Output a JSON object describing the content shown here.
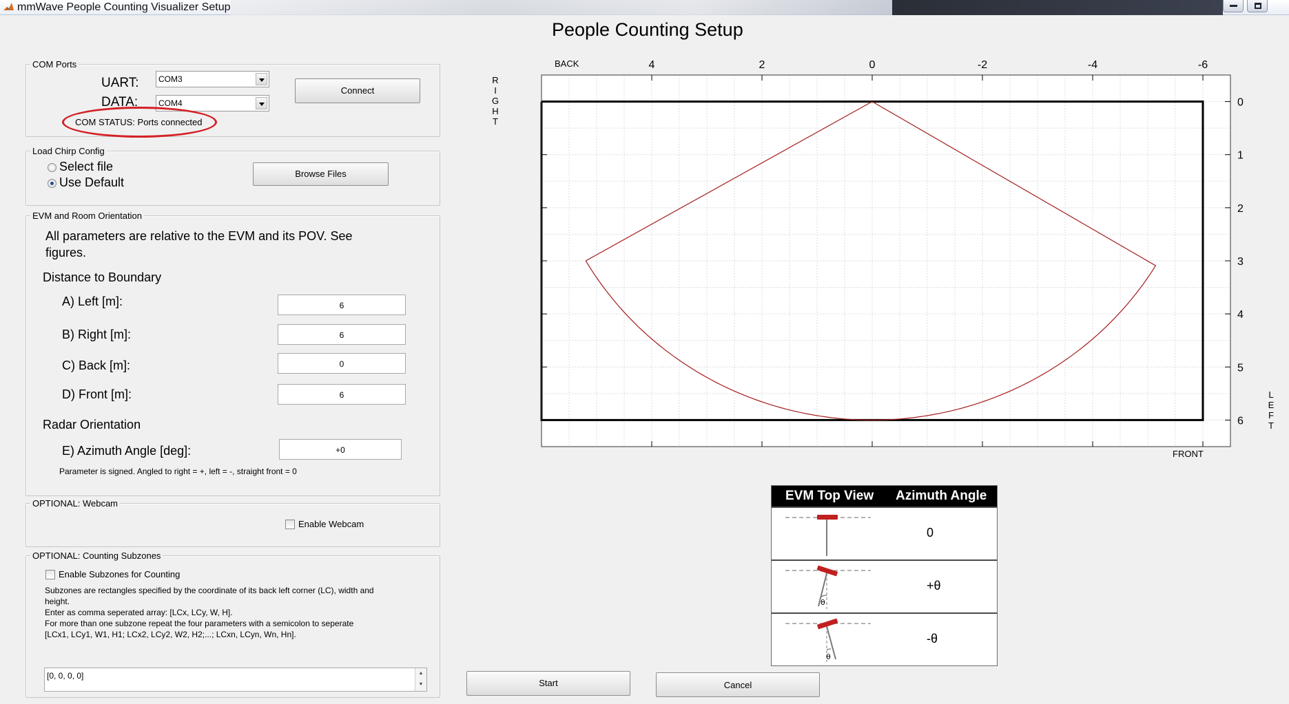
{
  "window": {
    "title": "mmWave People Counting Visualizer Setup"
  },
  "page_title": "People Counting Setup",
  "com_ports": {
    "legend": "COM Ports",
    "uart_label": "UART:",
    "uart_value": "COM3",
    "data_label": "DATA:",
    "data_value": "COM4",
    "connect_label": "Connect",
    "status": "COM STATUS: Ports connected"
  },
  "chirp_config": {
    "legend": "Load Chirp Config",
    "options": [
      "Select file",
      "Use Default"
    ],
    "selected": "Use Default",
    "browse_label": "Browse Files"
  },
  "orientation": {
    "legend": "EVM and Room Orientation",
    "intro_line1": "All parameters are relative to the EVM and its POV.  See",
    "intro_line2": "figures.",
    "distance_heading": "Distance to Boundary",
    "left_label": "A) Left [m]:",
    "left_value": "6",
    "right_label": "B) Right [m]:",
    "right_value": "6",
    "back_label": "C) Back [m]:",
    "back_value": "0",
    "front_label": "D) Front [m]:",
    "front_value": "6",
    "radar_heading": "Radar Orientation",
    "azimuth_label": "E) Azimuth Angle [deg]:",
    "azimuth_value": "+0",
    "azimuth_note": "Parameter is signed. Angled to right = +, left = -, straight front = 0"
  },
  "webcam": {
    "legend": "OPTIONAL: Webcam",
    "enable_label": "Enable Webcam",
    "checked": false
  },
  "subzones": {
    "legend": "OPTIONAL: Counting Subzones",
    "enable_label": "Enable Subzones for Counting",
    "checked": false,
    "help_lines": [
      "Subzones are rectangles specified by the coordinate of its back left corner (LC), width and",
      "height.",
      "Enter as comma seperated array: [LCx, LCy, W, H].",
      "For more than one subzone repeat the four parameters with a semicolon to seperate",
      "[LCx1, LCy1, W1, H1; LCx2, LCy2, W2, H2;...; LCxn, LCyn, Wn, Hn]."
    ],
    "input_value": "[0, 0, 0, 0]"
  },
  "buttons": {
    "start_label": "Start",
    "cancel_label": "Cancel"
  },
  "chart_data": {
    "type": "line",
    "title": "",
    "top_axis_label": "BACK",
    "bottom_axis_label": "FRONT",
    "left_axis_label": "RIGHT",
    "right_axis_label": "LEFT",
    "x_ticks": [
      4,
      2,
      0,
      -2,
      -4,
      -6
    ],
    "y_ticks": [
      0,
      1,
      2,
      3,
      4,
      5,
      6
    ],
    "xlim": [
      6,
      -6.5
    ],
    "ylim": [
      -0.5,
      6.5
    ],
    "grid": true,
    "colors": {
      "boundary": "#000000",
      "coverage": "#a31c1c",
      "grid": "#dcdcdc"
    },
    "series": [
      {
        "name": "",
        "role": "boundary",
        "x": [
          6,
          -6,
          -6,
          6,
          6
        ],
        "y": [
          0,
          0,
          6,
          6,
          0
        ]
      },
      {
        "name": "",
        "role": "coverage",
        "sector_apex": [
          0,
          0
        ],
        "sector_radius": 6,
        "sector_half_angle_deg": 60
      }
    ]
  },
  "evm_table": {
    "headers": [
      "EVM Top View",
      "Azimuth Angle"
    ],
    "rows": [
      {
        "angle": "0",
        "theta_label": ""
      },
      {
        "angle": "+θ",
        "theta_label": "θ"
      },
      {
        "angle": "-θ",
        "theta_label": "θ"
      }
    ],
    "colors": {
      "board": "#c0201e"
    }
  }
}
